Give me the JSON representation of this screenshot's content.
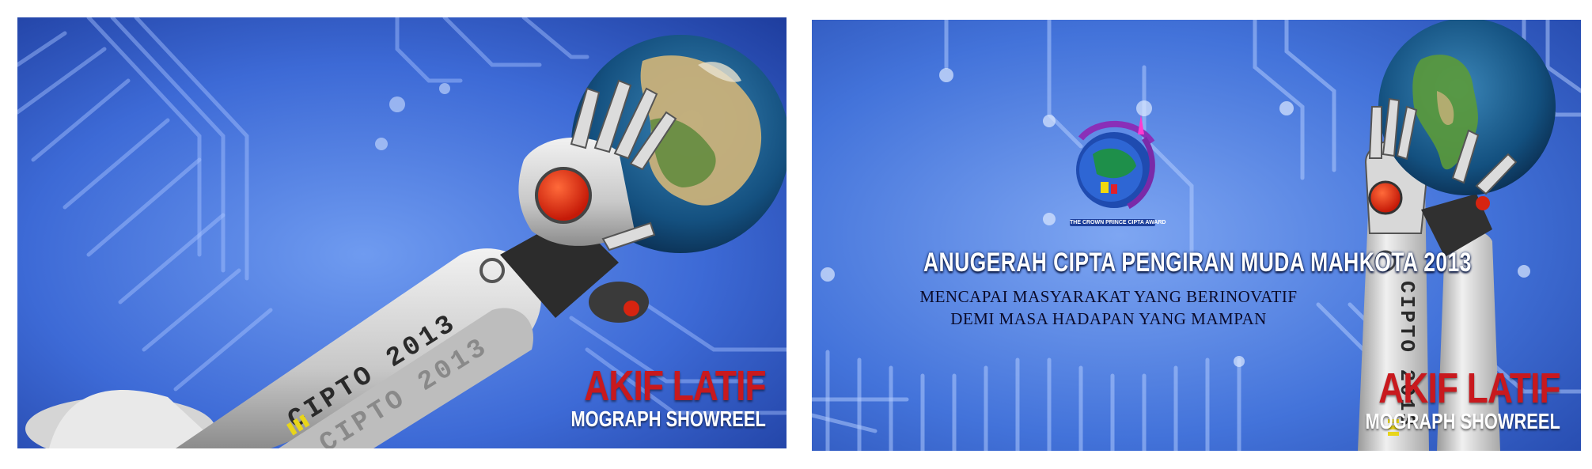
{
  "left_frame": {
    "description_icon": "robot-arm-holding-globe",
    "arm_text": "CIPTO 2013",
    "brand": {
      "name": "AKIF LATIF",
      "subtitle": "MOGRAPH SHOWREEL"
    }
  },
  "right_frame": {
    "logo_caption": "THE CROWN PRINCE CIPTA AWARD",
    "title": "ANUGERAH CIPTA PENGIRAN MUDA MAHKOTA 2013",
    "tagline_1": "MENCAPAI MASYARAKAT YANG BERINOVATIF",
    "tagline_2": "DEMI MASA HADAPAN YANG MAMPAN",
    "arm_text": "CIPTO 2013",
    "brand": {
      "name": "AKIF LATIF",
      "subtitle": "MOGRAPH SHOWREEL"
    }
  },
  "colors": {
    "background_blue": "#3f6fd8",
    "brand_red": "#c8191e",
    "accent_red": "#e23010"
  }
}
